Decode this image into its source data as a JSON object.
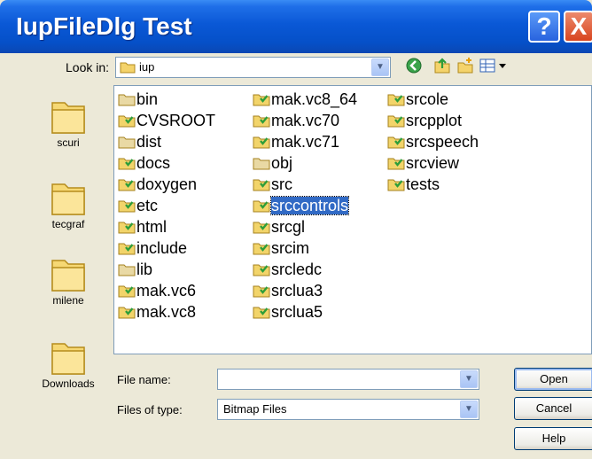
{
  "window": {
    "title": "IupFileDlg Test",
    "help_button": "?",
    "close_button": "X"
  },
  "lookin": {
    "label": "Look in:",
    "value": "iup"
  },
  "toolbar": {
    "icons": [
      "back-icon",
      "up-folder-icon",
      "new-folder-icon",
      "views-menu-icon"
    ]
  },
  "places": [
    {
      "label": "scuri",
      "icon": "folder-icon"
    },
    {
      "label": "tecgraf",
      "icon": "folder-icon"
    },
    {
      "label": "milene",
      "icon": "folder-icon"
    },
    {
      "label": "Downloads",
      "icon": "folder-icon"
    }
  ],
  "files": {
    "col1": [
      {
        "name": "bin",
        "status": "plain"
      },
      {
        "name": "CVSROOT",
        "status": "versioned"
      },
      {
        "name": "dist",
        "status": "plain"
      },
      {
        "name": "docs",
        "status": "versioned"
      },
      {
        "name": "doxygen",
        "status": "versioned"
      },
      {
        "name": "etc",
        "status": "versioned"
      },
      {
        "name": "html",
        "status": "versioned"
      },
      {
        "name": "include",
        "status": "versioned"
      },
      {
        "name": "lib",
        "status": "plain"
      },
      {
        "name": "mak.vc6",
        "status": "versioned"
      },
      {
        "name": "mak.vc8",
        "status": "versioned"
      }
    ],
    "col2": [
      {
        "name": "mak.vc8_64",
        "status": "versioned"
      },
      {
        "name": "mak.vc70",
        "status": "versioned"
      },
      {
        "name": "mak.vc71",
        "status": "versioned"
      },
      {
        "name": "obj",
        "status": "plain"
      },
      {
        "name": "src",
        "status": "versioned"
      },
      {
        "name": "srccontrols",
        "status": "versioned",
        "selected": true
      },
      {
        "name": "srcgl",
        "status": "versioned"
      },
      {
        "name": "srcim",
        "status": "versioned"
      },
      {
        "name": "srcledc",
        "status": "versioned"
      },
      {
        "name": "srclua3",
        "status": "versioned"
      },
      {
        "name": "srclua5",
        "status": "versioned"
      }
    ],
    "col3": [
      {
        "name": "srcole",
        "status": "versioned"
      },
      {
        "name": "srcpplot",
        "status": "versioned"
      },
      {
        "name": "srcspeech",
        "status": "versioned"
      },
      {
        "name": "srcview",
        "status": "versioned"
      },
      {
        "name": "tests",
        "status": "versioned"
      }
    ]
  },
  "filename": {
    "label": "File name:",
    "value": ""
  },
  "filetype": {
    "label": "Files of type:",
    "value": "Bitmap Files"
  },
  "buttons": {
    "open": "Open",
    "cancel": "Cancel",
    "help": "Help"
  },
  "colors": {
    "titlebar": "#0550c8",
    "selection": "#316ac5",
    "folder": "#f2c94c",
    "versioned_badge": "#2e9e3a",
    "dialog_bg": "#ece9d8"
  }
}
